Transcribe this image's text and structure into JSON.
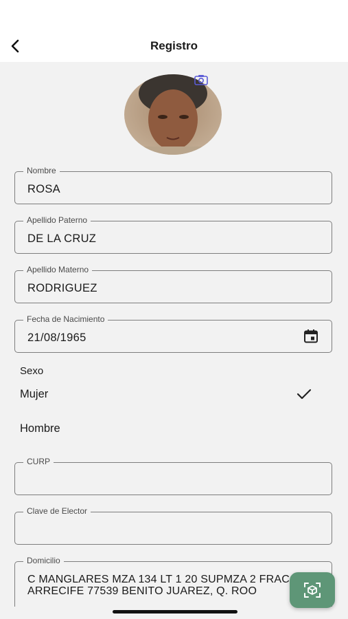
{
  "header": {
    "title": "Registro",
    "back_icon": "chevron-left-icon"
  },
  "avatar": {
    "icon": "camera-icon"
  },
  "fields": {
    "nombre": {
      "label": "Nombre",
      "value": "ROSA"
    },
    "apellido_paterno": {
      "label": "Apellido Paterno",
      "value": "DE LA CRUZ"
    },
    "apellido_materno": {
      "label": "Apellido Materno",
      "value": "RODRIGUEZ"
    },
    "fecha_nacimiento": {
      "label": "Fecha de Nacimiento",
      "value": "21/08/1965",
      "icon": "calendar-icon"
    },
    "curp": {
      "label": "CURP",
      "value": ""
    },
    "clave_elector": {
      "label": "Clave de Elector",
      "value": ""
    },
    "domicilio": {
      "label": "Domicilio",
      "value": "C MANGLARES MZA 134 LT 1 20 SUPMZA 2 FRACC ARRECIFE 77539 BENITO JUAREZ, Q. ROO"
    }
  },
  "sexo": {
    "label": "Sexo",
    "options": [
      {
        "label": "Mujer",
        "selected": true
      },
      {
        "label": "Hombre",
        "selected": false
      }
    ]
  },
  "fab": {
    "icon": "scan-cube-icon"
  },
  "colors": {
    "fab": "#5e9677",
    "background": "#f2f2f2",
    "camera": "#5b5bd6"
  }
}
